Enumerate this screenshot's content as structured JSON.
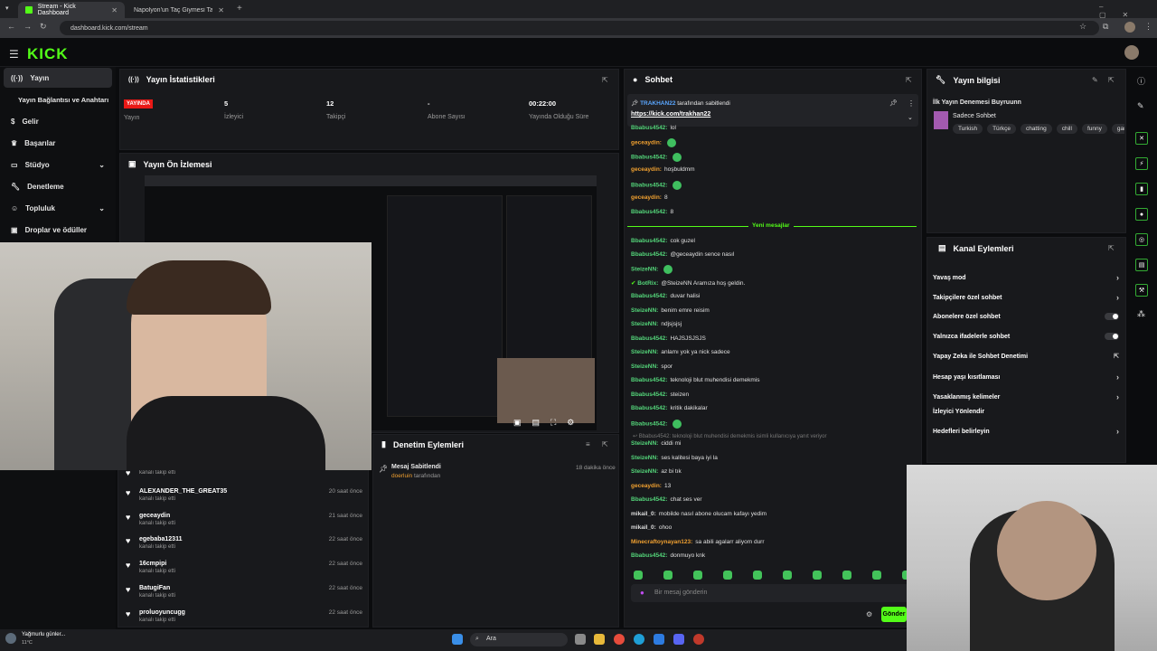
{
  "browser": {
    "tabs": [
      {
        "label": "Stream - Kick Dashboard"
      },
      {
        "label": "Napolyon'un Taç Giymesi Tablo"
      }
    ],
    "url": "dashboard.kick.com/stream"
  },
  "header": {
    "logo": "KICK"
  },
  "sidebar": {
    "items": [
      {
        "label": "Yayın",
        "icon": "broadcast-icon"
      },
      {
        "label": "Yayın Bağlantısı ve Anahtarı",
        "icon": ""
      },
      {
        "label": "Gelir",
        "icon": "dollar-icon"
      },
      {
        "label": "Başarılar",
        "icon": "trophy-icon"
      },
      {
        "label": "Stüdyo",
        "icon": "monitor-icon"
      },
      {
        "label": "Denetleme",
        "icon": "wrench-icon"
      },
      {
        "label": "Topluluk",
        "icon": "people-icon"
      },
      {
        "label": "Droplar ve ödüller",
        "icon": "gift-icon"
      }
    ]
  },
  "stats": {
    "title": "Yayın İstatistikleri",
    "live_badge": "YAYINDA",
    "items": [
      {
        "value": "",
        "label": "Yayın"
      },
      {
        "value": "5",
        "label": "İzleyici"
      },
      {
        "value": "12",
        "label": "Takipçi"
      },
      {
        "value": "-",
        "label": "Abone Sayısı"
      },
      {
        "value": "00:22:00",
        "label": "Yayında Olduğu Süre"
      }
    ]
  },
  "preview": {
    "title": "Yayın Ön İzlemesi"
  },
  "activity": [
    {
      "name": "",
      "sub": "kanalı takip etti",
      "time": ""
    },
    {
      "name": "ALEXANDER_THE_GREAT35",
      "sub": "kanalı takip etti",
      "time": "20 saat önce"
    },
    {
      "name": "geceaydin",
      "sub": "kanalı takip etti",
      "time": "21 saat önce"
    },
    {
      "name": "egebaba12311",
      "sub": "kanalı takip etti",
      "time": "22 saat önce"
    },
    {
      "name": "16cmpipi",
      "sub": "kanalı takip etti",
      "time": "22 saat önce"
    },
    {
      "name": "BatugiFan",
      "sub": "kanalı takip etti",
      "time": "22 saat önce"
    },
    {
      "name": "proluoyuncugg",
      "sub": "kanalı takip etti",
      "time": "22 saat önce"
    }
  ],
  "moderation": {
    "title": "Denetim Eylemleri",
    "item_title": "Mesaj Sabitlendi",
    "item_user": "doerluin",
    "item_suffix": "tarafından",
    "item_time": "18 dakika önce"
  },
  "chat": {
    "title": "Sohbet",
    "pinned_by": "TRAKHAN22",
    "pinned_suffix": "tarafından sabitlendi",
    "pinned_link": "https://kick.com/trakhan22",
    "new_messages": "Yeni mesajlar",
    "messages": [
      {
        "user": "Bbabus4542:",
        "text": "lol",
        "c": "g"
      },
      {
        "user": "geceaydin:",
        "text": "",
        "c": "o"
      },
      {
        "user": "Bbabus4542:",
        "text": "",
        "c": "g"
      },
      {
        "user": "geceaydin:",
        "text": "hoşbuldmm",
        "c": "o"
      },
      {
        "user": "Bbabus4542:",
        "text": "",
        "c": "g"
      },
      {
        "user": "geceaydin:",
        "text": "8",
        "c": "o"
      },
      {
        "user": "Bbabus4542:",
        "text": "8",
        "c": "g"
      },
      {
        "user": "Bbabus4542:",
        "text": "cok guzel",
        "c": "g"
      },
      {
        "user": "Bbabus4542:",
        "text": "@geceaydin sence nasıl",
        "c": "g"
      },
      {
        "user": "SteizeNN:",
        "text": "",
        "c": "g"
      },
      {
        "user": "BotRix:",
        "text": "@SteizeNN Aramıza hoş geldin.",
        "c": "g"
      },
      {
        "user": "Bbabus4542:",
        "text": "duvar halisi",
        "c": "g"
      },
      {
        "user": "SteizeNN:",
        "text": "benim emre reisim",
        "c": "g"
      },
      {
        "user": "SteizeNN:",
        "text": "ndjsjsjsj",
        "c": "g"
      },
      {
        "user": "Bbabus4542:",
        "text": "HAJSJSJSJS",
        "c": "g"
      },
      {
        "user": "SteizeNN:",
        "text": "anlamı yok ya nick sadece",
        "c": "g"
      },
      {
        "user": "SteizeNN:",
        "text": "spor",
        "c": "g"
      },
      {
        "user": "Bbabus4542:",
        "text": "teknoloji blut muhendisi demekmis",
        "c": "g"
      },
      {
        "user": "Bbabus4542:",
        "text": "steizen",
        "c": "g"
      },
      {
        "user": "Bbabus4542:",
        "text": "kritik dakikalar",
        "c": "g"
      },
      {
        "user": "Bbabus4542:",
        "text": "",
        "c": "g"
      },
      {
        "user": "SteizeNN:",
        "text": "ciddi mi",
        "c": "g"
      },
      {
        "user": "SteizeNN:",
        "text": "ses kalitesi baya iyi la",
        "c": "g"
      },
      {
        "user": "SteizeNN:",
        "text": "az bi tık",
        "c": "g"
      },
      {
        "user": "geceaydin:",
        "text": "13",
        "c": "o"
      },
      {
        "user": "Bbabus4542:",
        "text": "chat ses ver",
        "c": "g"
      },
      {
        "user": "mikail_0:",
        "text": "mobilde nasıl abone olucam kafayı yedim",
        "c": "w"
      },
      {
        "user": "mikail_0:",
        "text": "ohoo",
        "c": "w"
      },
      {
        "user": "Minecraftoynayan123:",
        "text": "sa abili agalarr aliyom durr",
        "c": "o"
      },
      {
        "user": "Bbabus4542:",
        "text": "donmuyo knk",
        "c": "g"
      }
    ],
    "reply_hint": "Bbabus4542: teknoloji blut muhendisi demekmis isimli kullanıcıya yanıt veriyor",
    "input_placeholder": "Bir mesaj gönderin",
    "send_label": "Gönder"
  },
  "stream_info": {
    "title": "Yayın bilgisi",
    "stream_title": "İlk Yayın Denemesi Buyruunn",
    "category": "Sadece Sohbet",
    "tags": [
      "Turkish",
      "Türkçe",
      "chatting",
      "chill",
      "funny",
      "gam"
    ]
  },
  "channel_actions": {
    "title": "Kanal Eylemleri",
    "rows": [
      {
        "label": "Yavaş mod",
        "kind": "arrow"
      },
      {
        "label": "Takipçilere özel sohbet",
        "kind": "arrow"
      },
      {
        "label": "Abonelere özel sohbet",
        "kind": "toggle"
      },
      {
        "label": "Yalnızca ifadelerle sohbet",
        "kind": "toggle"
      },
      {
        "label": "Yapay Zeka ile Sohbet Denetimi",
        "kind": "ext"
      },
      {
        "label": "Hesap yaşı kısıtlaması",
        "kind": "arrow"
      },
      {
        "label": "Yasaklanmış kelimeler",
        "kind": "arrow"
      },
      {
        "label": "İzleyici Yönlendir",
        "kind": "none"
      },
      {
        "label": "Hedefleri belirleyin",
        "kind": "arrow"
      }
    ]
  },
  "taskbar": {
    "weather": "Yağmurlu günler...",
    "temp": "11°C",
    "search": "Ara"
  },
  "colors": {
    "accent": "#53fc18",
    "live": "#e91916",
    "panel": "#18191c"
  }
}
